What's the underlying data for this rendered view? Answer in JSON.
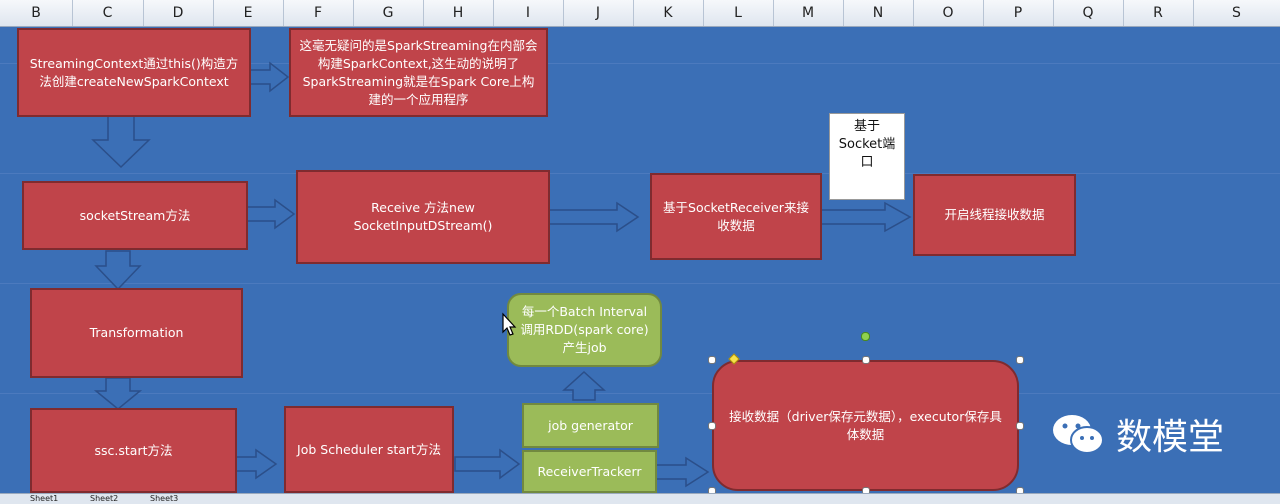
{
  "columns": [
    "B",
    "C",
    "D",
    "E",
    "F",
    "G",
    "H",
    "I",
    "J",
    "K",
    "L",
    "M",
    "N",
    "O",
    "P",
    "Q",
    "R",
    "S"
  ],
  "boxes": {
    "streaming_context": "StreamingContext通过this()构造方法创建createNewSparkContext",
    "spark_context_note": "这毫无疑问的是SparkStreaming在内部会构建SparkContext,这生动的说明了SparkStreaming就是在Spark Core上构建的一个应用程序",
    "socket_stream": "socketStream方法",
    "receive": "Receive 方法new SocketInputDStream()",
    "socket_receiver": "基于SocketReceiver来接收数据",
    "socket_port_note": "基于Socket端口",
    "start_thread": "开启线程接收数据",
    "transformation": "Transformation",
    "batch_interval": "每一个Batch Interval调用RDD(spark core)产生job",
    "ssc_start": "ssc.start方法",
    "job_scheduler": "Job Scheduler start方法",
    "job_generator": "job generator",
    "receiver_tracker": "ReceiverTrackerr",
    "receive_data": "接收数据（driver保存元数据），executor保存具体数据"
  },
  "watermark": {
    "text": "数模堂",
    "icon": "wechat-icon"
  },
  "tabs": [
    "Sheet1",
    "Sheet2",
    "Sheet3"
  ],
  "colors": {
    "background": "#3b6fb6",
    "red_box": "#c0444a",
    "green_box": "#9bbb59"
  }
}
